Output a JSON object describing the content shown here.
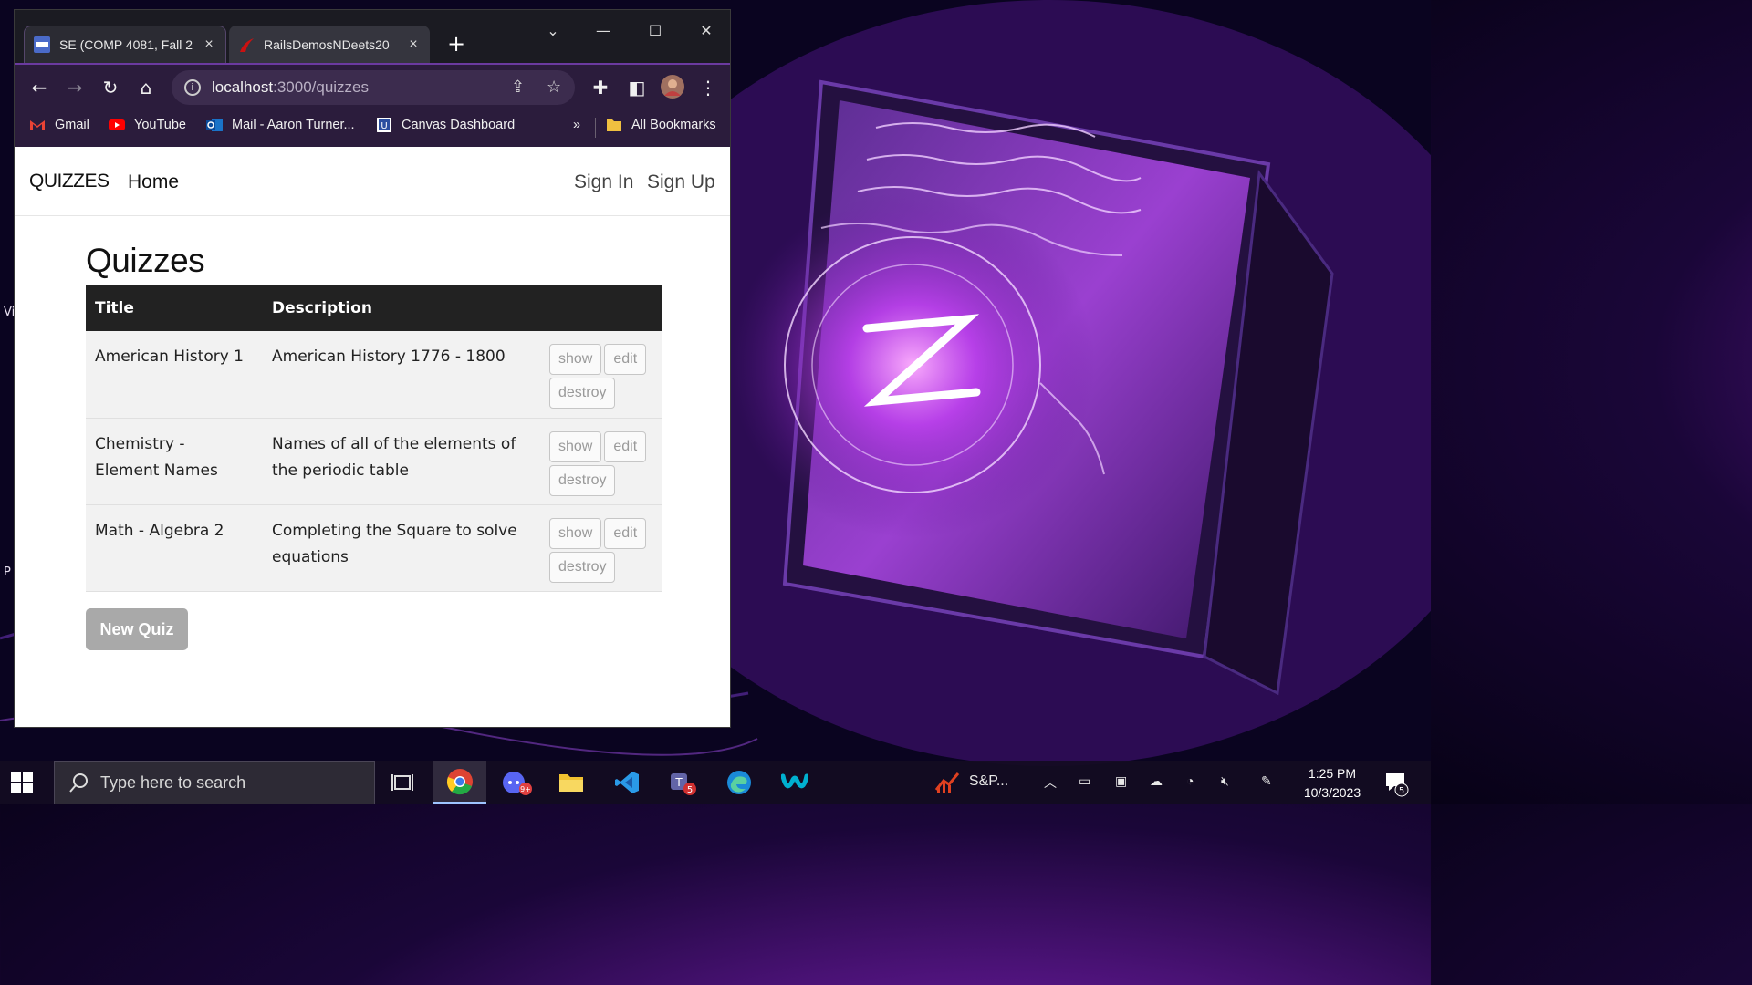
{
  "browser": {
    "tabs": [
      {
        "label": "SE (COMP 4081, Fall 2",
        "favicon_text": "COMP 4081",
        "close": "×"
      },
      {
        "label": "RailsDemosNDeets20",
        "close": "×"
      }
    ],
    "new_tab": "+",
    "window_controls": {
      "minimize": "—",
      "maximize": "☐",
      "close": "✕",
      "tab_search": "⌄"
    },
    "url_host": "localhost",
    "url_path": ":3000/quizzes",
    "bookmarks": [
      {
        "label": "Gmail",
        "icon": "gmail-icon"
      },
      {
        "label": "YouTube",
        "icon": "youtube-icon"
      },
      {
        "label": "Mail - Aaron Turner...",
        "icon": "outlook-icon"
      },
      {
        "label": "Canvas Dashboard",
        "icon": "canvas-icon"
      }
    ],
    "bookmarks_overflow": "»",
    "all_bookmarks": "All Bookmarks"
  },
  "app": {
    "brand": "QUIZZES",
    "nav_home": "Home",
    "nav_sign_in": "Sign In",
    "nav_sign_up": "Sign Up",
    "page_title": "Quizzes",
    "table": {
      "headers": [
        "Title",
        "Description",
        ""
      ],
      "rows": [
        {
          "title": "American History 1",
          "description": "American History 1776 - 1800"
        },
        {
          "title": "Chemistry - Element Names",
          "description": "Names of all of the elements of the periodic table"
        },
        {
          "title": "Math - Algebra 2",
          "description": "Completing the Square to solve equations"
        }
      ],
      "actions": {
        "show": "show",
        "edit": "edit",
        "destroy": "destroy"
      }
    },
    "new_quiz": "New Quiz"
  },
  "taskbar": {
    "search_placeholder": "Type here to search",
    "pinned_app_label": "S&P...",
    "time": "1:25 PM",
    "date": "10/3/2023",
    "notification_count": "5",
    "discord_badge": "9+",
    "teams_badge": "5"
  },
  "colors": {
    "accent_purple": "#6b3aa0",
    "header_dark": "#222222",
    "row_bg": "#f2f2f2",
    "new_quiz_bg": "#a9a9a9"
  }
}
